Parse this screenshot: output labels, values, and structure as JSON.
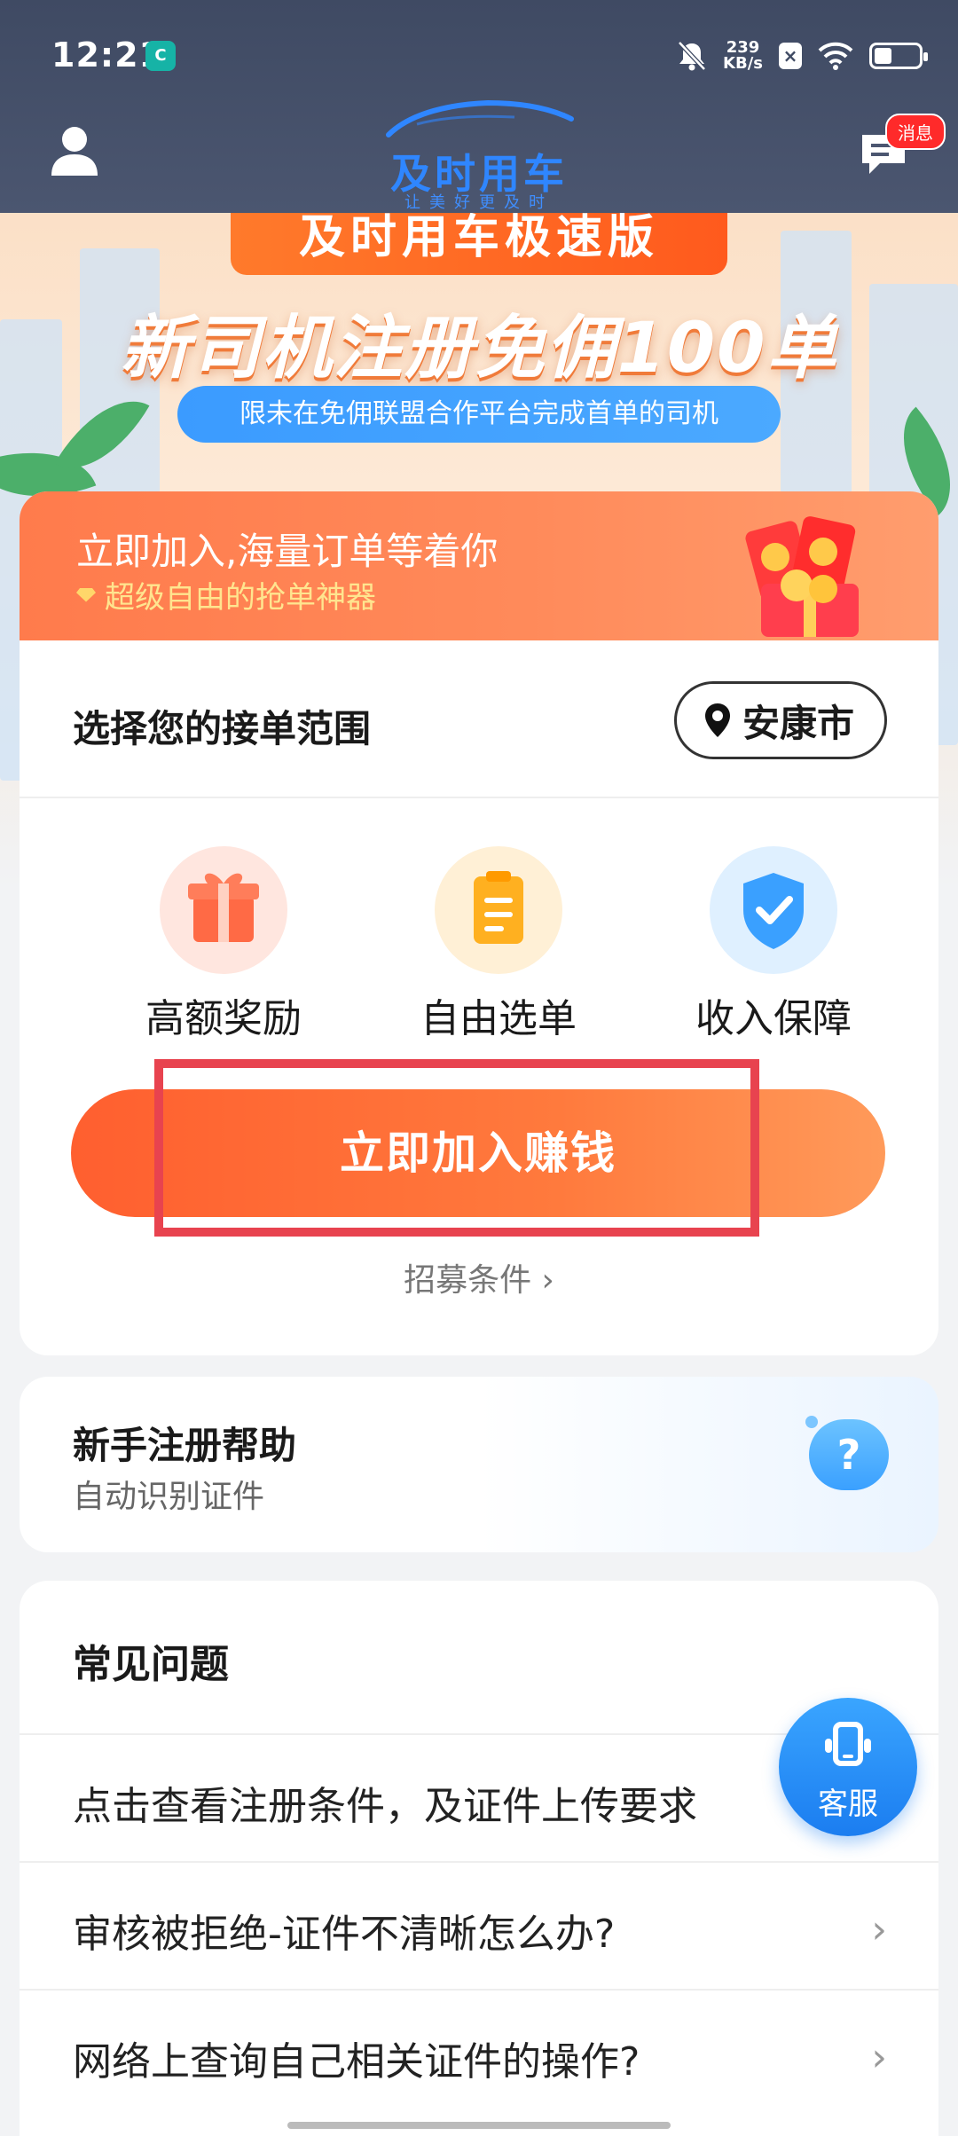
{
  "status_bar": {
    "time": "12:21",
    "network_speed": "239\nKB/s",
    "speed_value": "239",
    "speed_unit": "KB/s"
  },
  "header": {
    "logo_title": "及时用车",
    "logo_subtitle": "让美好更及时",
    "message_badge": "消息"
  },
  "banner": {
    "ribbon": "及时用车极速版",
    "headline": "新司机注册免佣100单",
    "pill_text": "限未在免佣联盟合作平台完成首单的司机"
  },
  "main_card": {
    "title": "立即加入,海量订单等着你",
    "subtitle": "超级自由的抢单神器",
    "range_label": "选择您的接单范围",
    "city": "安康市",
    "features": [
      {
        "label": "高额奖励",
        "icon": "gift-icon",
        "color": "#ff6a45"
      },
      {
        "label": "自由选单",
        "icon": "clipboard-icon",
        "color": "#ffb020"
      },
      {
        "label": "收入保障",
        "icon": "shield-check-icon",
        "color": "#3aa0ff"
      }
    ],
    "join_button": "立即加入赚钱",
    "conditions_link": "招募条件 ›"
  },
  "help_card": {
    "title": "新手注册帮助",
    "subtitle": "自动识别证件",
    "bubble": "?"
  },
  "faq": {
    "title": "常见问题",
    "items": [
      {
        "text": "点击查看注册条件，及证件上传要求"
      },
      {
        "text": "审核被拒绝-证件不清晰怎么办?"
      },
      {
        "text": "网络上查询自己相关证件的操作?"
      }
    ]
  },
  "service_button": {
    "label": "客服"
  },
  "colors": {
    "accent_orange": "#ff6a3d",
    "brand_blue": "#2f86ff",
    "highlight_red": "#e8434f"
  }
}
